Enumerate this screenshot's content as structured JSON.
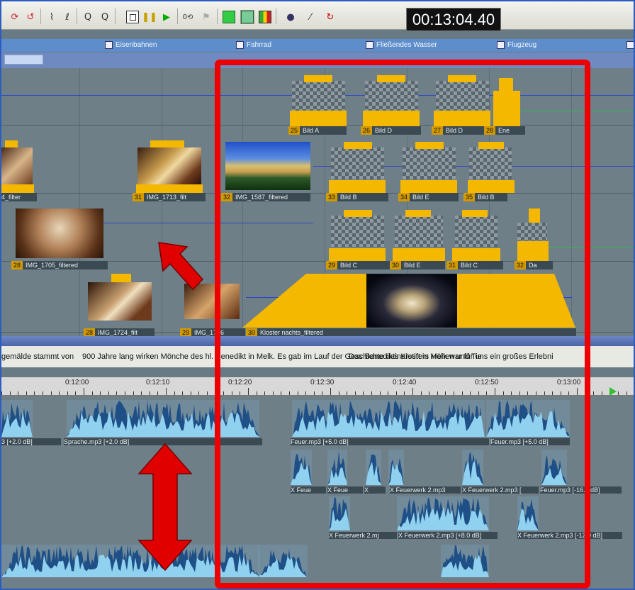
{
  "toolbar": {
    "timecode": "00:13:04.40",
    "icons": [
      "refresh-icon",
      "undo-icon",
      "cut-icon",
      "link-icon",
      "zoom-in-icon",
      "zoom-out-icon",
      "stop-icon",
      "pause-icon",
      "play-icon",
      "loop-icon",
      "effect-icon",
      "view-icon",
      "view-active-icon",
      "color-icon",
      "dots-icon",
      "wand-icon",
      "rotate-icon"
    ]
  },
  "transitions": [
    "Eisenbahnen",
    "Fahrrad",
    "Fließendes Wasser",
    "Flugzeug"
  ],
  "video_clips": [
    {
      "num": "25",
      "name": "Bild A"
    },
    {
      "num": "26",
      "name": "Bild D"
    },
    {
      "num": "27",
      "name": "Bild D"
    },
    {
      "num": "28",
      "name": "Ene"
    },
    {
      "num": "33",
      "name": "Bild B"
    },
    {
      "num": "34",
      "name": "Bild E"
    },
    {
      "num": "35",
      "name": "Bild B"
    },
    {
      "num": "31",
      "name": "IMG_1713_filt"
    },
    {
      "num": "32",
      "name": "IMG_1587_filtered"
    },
    {
      "num": "",
      "name": "4_filter"
    },
    {
      "num": "28",
      "name": "IMG_1705_filtered"
    },
    {
      "num": "29",
      "name": "Bild C"
    },
    {
      "num": "30",
      "name": "Bild E"
    },
    {
      "num": "31",
      "name": "Bild C"
    },
    {
      "num": "32",
      "name": "Da"
    },
    {
      "num": "28",
      "name": "IMG_1724_filt"
    },
    {
      "num": "29",
      "name": "IMG_1716"
    },
    {
      "num": "30",
      "name": "Kloster nachts_filtered"
    }
  ],
  "text_track": [
    "gemälde stammt von",
    "900 Jahre lang wirken Mönche des hl. Benedikt in Melk. Es gab im Lauf der Geschichte des Klosters Höhen und Tie",
    "Das Benediktinerstift in Melk war für uns ein großes Erlebni"
  ],
  "ruler": [
    "0:12:00",
    "0:12:10",
    "0:12:20",
    "0:12:30",
    "0:12:40",
    "0:12:50",
    "0:13:00"
  ],
  "audio_labels": [
    {
      "text": "3 [+2.0 dB]"
    },
    {
      "text": "Sprache.mp3 [+2.0 dB]"
    },
    {
      "text": "Feuer.mp3 [+5.0 dB]"
    },
    {
      "text": "Feuer.mp3 [+5.0 dB]"
    },
    {
      "text": "X Feue"
    },
    {
      "text": "X Feue"
    },
    {
      "text": "X"
    },
    {
      "text": "X Feuerwerk 2.mp3"
    },
    {
      "text": "X Feuerwerk 2.mp3 ["
    },
    {
      "text": "Feuer.mp3 [-16.0 dB]"
    },
    {
      "text": "X Feuerwerk 2.mj"
    },
    {
      "text": "X Feuerwerk 2.mp3 [+8.0 dB]"
    },
    {
      "text": "X Feuerwerk 2.mp3 [-12.0 dB]"
    }
  ],
  "colors": {
    "highlight": "#ee0000",
    "clip_transition": "#f4b800",
    "wave_dark": "#1e4f86",
    "wave_light": "#8fd1ee"
  }
}
